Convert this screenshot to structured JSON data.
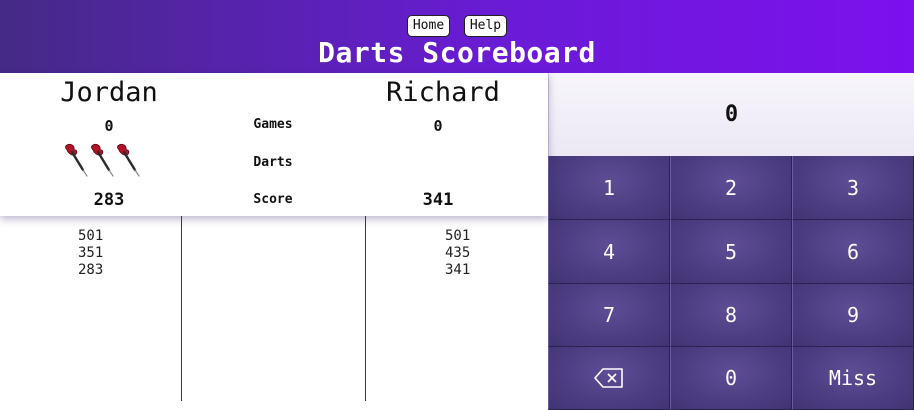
{
  "nav": {
    "home_label": "Home",
    "help_label": "Help"
  },
  "title": "Darts Scoreboard",
  "labels": {
    "games": "Games",
    "darts": "Darts",
    "score": "Score"
  },
  "players": [
    {
      "name": "Jordan",
      "games": "0",
      "darts_remaining": 3,
      "score": "283",
      "history": [
        "501",
        "351",
        "283"
      ]
    },
    {
      "name": "Richard",
      "games": "0",
      "darts_remaining": 0,
      "score": "341",
      "history": [
        "501",
        "435",
        "341"
      ]
    }
  ],
  "display_value": "0",
  "keypad": {
    "keys": [
      "1",
      "2",
      "3",
      "4",
      "5",
      "6",
      "7",
      "8",
      "9"
    ],
    "backspace_icon": "backspace-icon",
    "zero": "0",
    "miss": "Miss"
  },
  "colors": {
    "header_start": "#452a86",
    "header_end": "#7d10ee",
    "key": "#4b3c80",
    "dart_flight": "#b3122b"
  }
}
